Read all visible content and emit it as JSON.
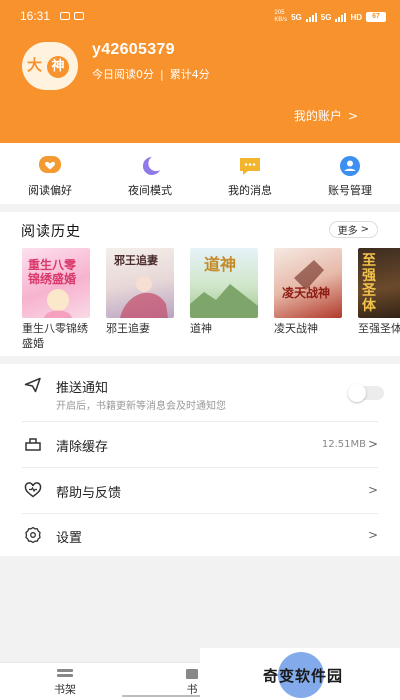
{
  "status_bar": {
    "time": "16:31",
    "net_speed": "205",
    "net_unit": "KB/s",
    "signal_1": "5G",
    "signal_2": "5G",
    "signal_3": "HD",
    "battery": "67"
  },
  "profile": {
    "avatar_char_1": "大",
    "avatar_char_2": "神",
    "username": "y42605379",
    "today_reading": "今日阅读0分",
    "separator": "|",
    "total_reading": "累计4分",
    "account_link": "我的账户",
    "chevron": ">"
  },
  "quick_actions": [
    {
      "label": "阅读偏好",
      "icon": "heart-icon",
      "color": "#f39a33"
    },
    {
      "label": "夜间模式",
      "icon": "moon-icon",
      "color": "#8f7ae8"
    },
    {
      "label": "我的消息",
      "icon": "message-icon",
      "color": "#f3b52e"
    },
    {
      "label": "账号管理",
      "icon": "account-icon",
      "color": "#3d8ff2"
    }
  ],
  "history": {
    "title": "阅读历史",
    "more_label": "更多",
    "more_chevron": ">",
    "books": [
      {
        "title": "重生八零锦绣盛婚",
        "cover_text": "重生八零锦绣盛婚"
      },
      {
        "title": "邪王追妻",
        "cover_text": "邪王追妻"
      },
      {
        "title": "道神",
        "cover_text": "道神"
      },
      {
        "title": "凌天战神",
        "cover_text": "凌天战神"
      },
      {
        "title": "至强圣体",
        "cover_text": "至强圣体"
      }
    ]
  },
  "settings": {
    "push": {
      "label": "推送通知",
      "sub": "开启后，书籍更新等消息会及时通知您",
      "enabled": false
    },
    "cache": {
      "label": "清除缓存",
      "value": "12.51MB",
      "chevron": ">"
    },
    "help": {
      "label": "帮助与反馈",
      "chevron": ">"
    },
    "settings": {
      "label": "设置",
      "chevron": ">"
    }
  },
  "bottom_nav": {
    "items": [
      {
        "label": "书架"
      },
      {
        "label": "书"
      }
    ]
  },
  "watermark": {
    "text": "奇变软件园"
  },
  "colors": {
    "header": "#f8922c",
    "accent": "#f8922c"
  }
}
